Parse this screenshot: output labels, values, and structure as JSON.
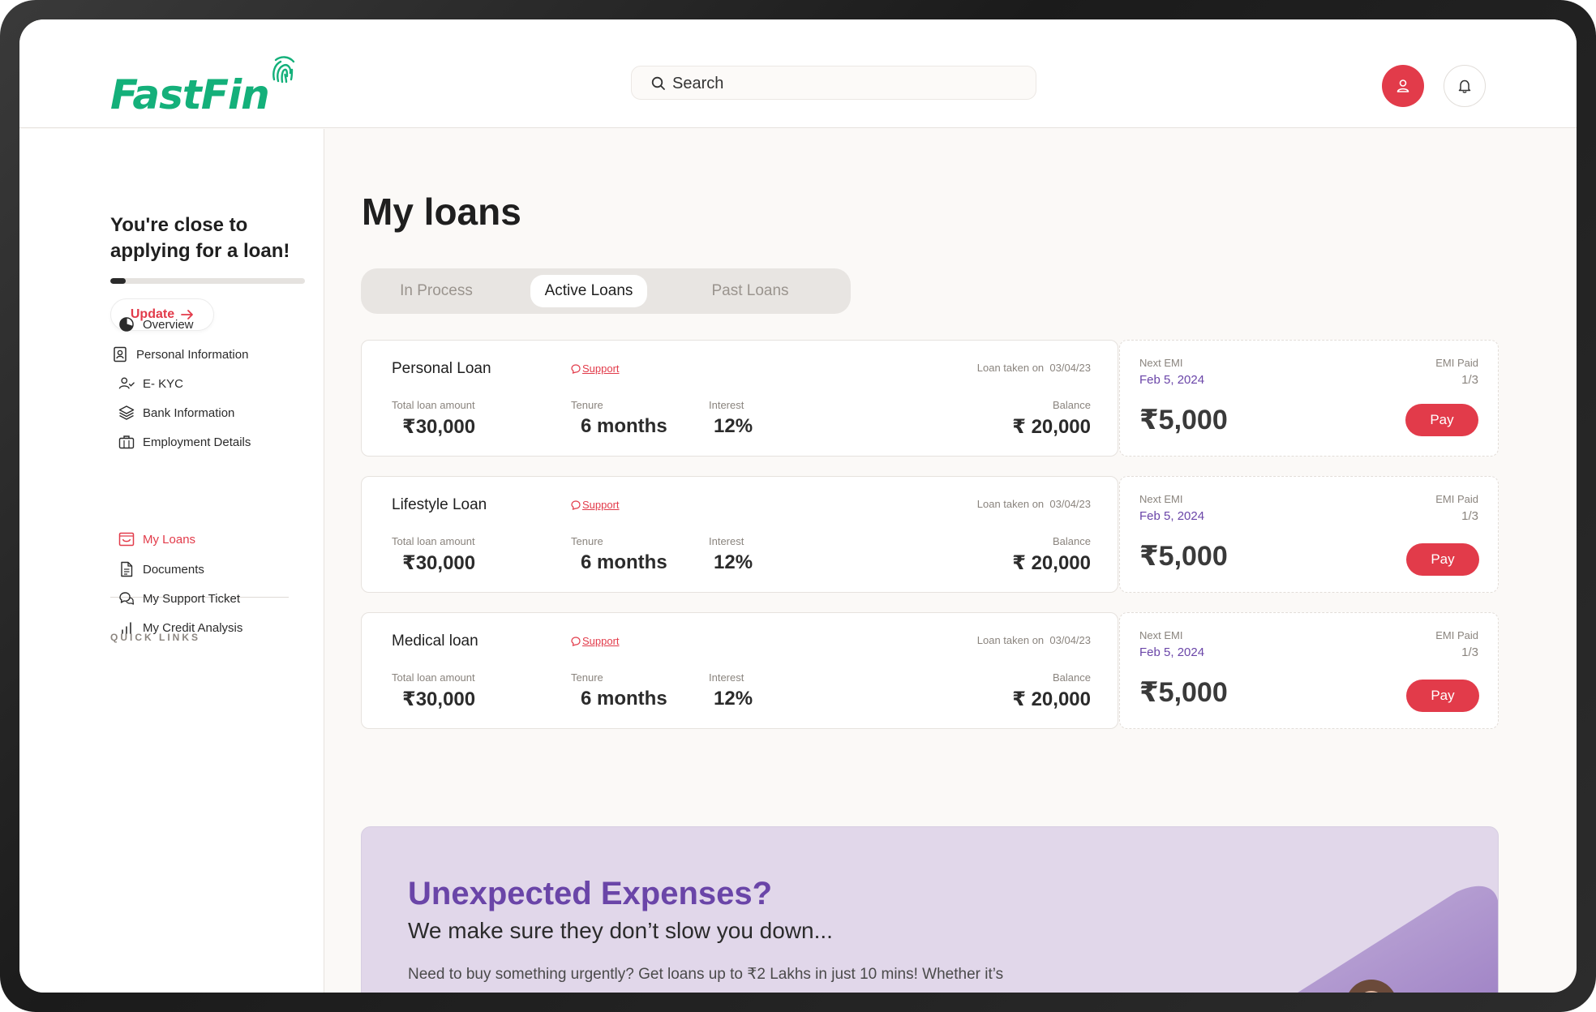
{
  "header": {
    "logo": "FastFin",
    "search_placeholder": "Search"
  },
  "sidebar": {
    "promo_title": "You're close to applying for a loan!",
    "progress_fraction": 0.08,
    "update_label": "Update",
    "nav_items": [
      {
        "label": "Overview",
        "icon": "pie-chart-icon"
      },
      {
        "label": "Personal Information",
        "icon": "id-card-icon"
      },
      {
        "label": "E- KYC",
        "icon": "user-check-icon"
      },
      {
        "label": "Bank Information",
        "icon": "layers-icon"
      },
      {
        "label": "Employment Details",
        "icon": "briefcase-icon"
      }
    ],
    "quick_links_title": "QUICK LINKS",
    "quick_links": [
      {
        "label": "My Loans",
        "icon": "inbox-icon",
        "active": true
      },
      {
        "label": "Documents",
        "icon": "document-icon"
      },
      {
        "label": "My Support Ticket",
        "icon": "chat-icon"
      },
      {
        "label": "My Credit Analysis",
        "icon": "bar-chart-icon"
      }
    ]
  },
  "main": {
    "title": "My loans",
    "tabs": [
      {
        "label": "In Process"
      },
      {
        "label": "Active Loans",
        "active": true
      },
      {
        "label": "Past Loans"
      }
    ],
    "labels": {
      "support": "Support",
      "loan_taken_on": "Loan taken on",
      "total_loan_amount": "Total loan amount",
      "tenure": "Tenure",
      "interest": "Interest",
      "balance": "Balance",
      "next_emi": "Next EMI",
      "emi_paid": "EMI Paid",
      "pay": "Pay"
    },
    "loans": [
      {
        "name": "Personal Loan",
        "taken_on": "03/04/23",
        "total": "₹30,000",
        "tenure": "6 months",
        "interest": "12%",
        "balance": "₹ 20,000",
        "next_emi_date": "Feb 5, 2024",
        "emi_paid": "1/3",
        "emi_amount": "₹5,000"
      },
      {
        "name": "Lifestyle Loan",
        "taken_on": "03/04/23",
        "total": "₹30,000",
        "tenure": "6 months",
        "interest": "12%",
        "balance": "₹ 20,000",
        "next_emi_date": "Feb 5, 2024",
        "emi_paid": "1/3",
        "emi_amount": "₹5,000"
      },
      {
        "name": "Medical loan",
        "taken_on": "03/04/23",
        "total": "₹30,000",
        "tenure": "6 months",
        "interest": "12%",
        "balance": "₹ 20,000",
        "next_emi_date": "Feb 5, 2024",
        "emi_paid": "1/3",
        "emi_amount": "₹5,000"
      }
    ],
    "banner": {
      "title": "Unexpected Expenses?",
      "subtitle": "We make sure they don’t slow you down...",
      "text": "Need to buy something urgently? Get loans up to ₹2 Lakhs in just 10 mins! Whether it’s"
    }
  },
  "colors": {
    "brand": "#14b07a",
    "accent": "#e23b4a",
    "purple": "#6a45a8"
  }
}
